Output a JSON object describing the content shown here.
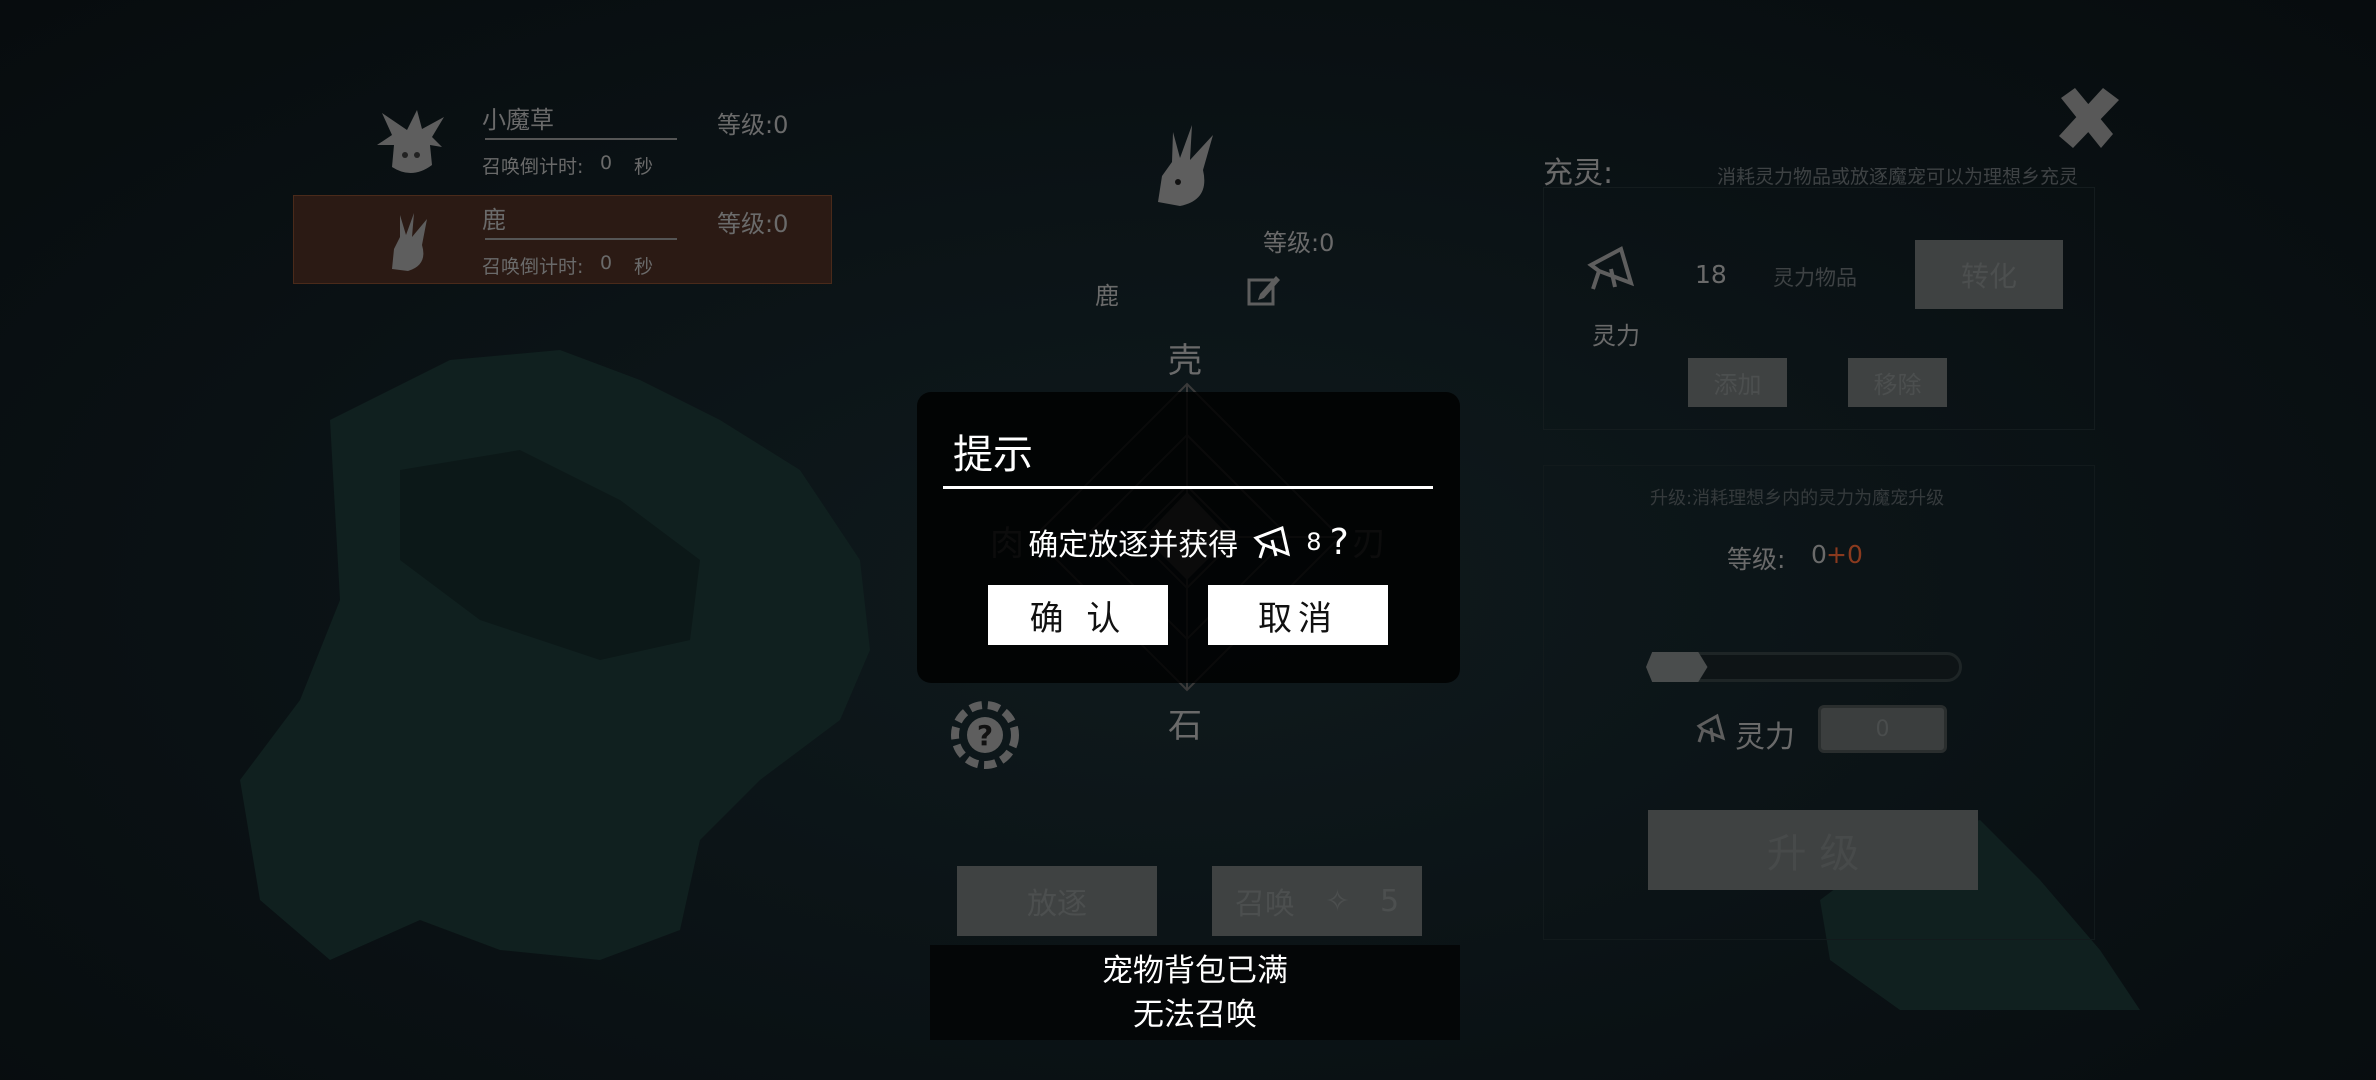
{
  "pet_list": [
    {
      "name": "小魔草",
      "level": "等级:0",
      "countdown_label": "召唤倒计时:",
      "countdown_value": "0",
      "countdown_unit": "秒",
      "icon": "grass-sprite-icon",
      "selected": false
    },
    {
      "name": "鹿",
      "level": "等级:0",
      "countdown_label": "召唤倒计时:",
      "countdown_value": "0",
      "countdown_unit": "秒",
      "icon": "deer-icon",
      "selected": true
    }
  ],
  "detail": {
    "name": "鹿",
    "level": "等级:0",
    "icon": "deer-icon",
    "edit_icon": "edit-icon",
    "radar_labels": {
      "top": "壳",
      "left": "肉",
      "right": "刃",
      "bottom": "石"
    },
    "help_icon": "question-gear-icon",
    "banish_label": "放逐",
    "summon_label": "召唤",
    "summon_cost": "5"
  },
  "dialog": {
    "title": "提示",
    "message": "确定放逐并获得",
    "amount": "8",
    "suffix": "?",
    "confirm": "确 认",
    "cancel": "取消"
  },
  "toast": {
    "line1": "宠物背包已满",
    "line2": "无法召唤"
  },
  "charge": {
    "title": "充灵:",
    "description": "消耗灵力物品或放逐魔宠可以为理想乡充灵",
    "spirit_label": "灵力",
    "spirit_value": "18",
    "item_label": "灵力物品",
    "convert": "转化",
    "add": "添加",
    "remove": "移除"
  },
  "upgrade": {
    "description": "升级:消耗理想乡内的灵力为魔宠升级",
    "level_label": "等级:",
    "level_value": "0",
    "level_bonus": "+0",
    "progress": 0.1,
    "spirit_label": "灵力",
    "spirit_input": "0",
    "button": "升 级"
  },
  "colors": {
    "highlight": "#2b1a14",
    "bonus": "#8a3a1e",
    "accent_text": "#ffffff"
  }
}
